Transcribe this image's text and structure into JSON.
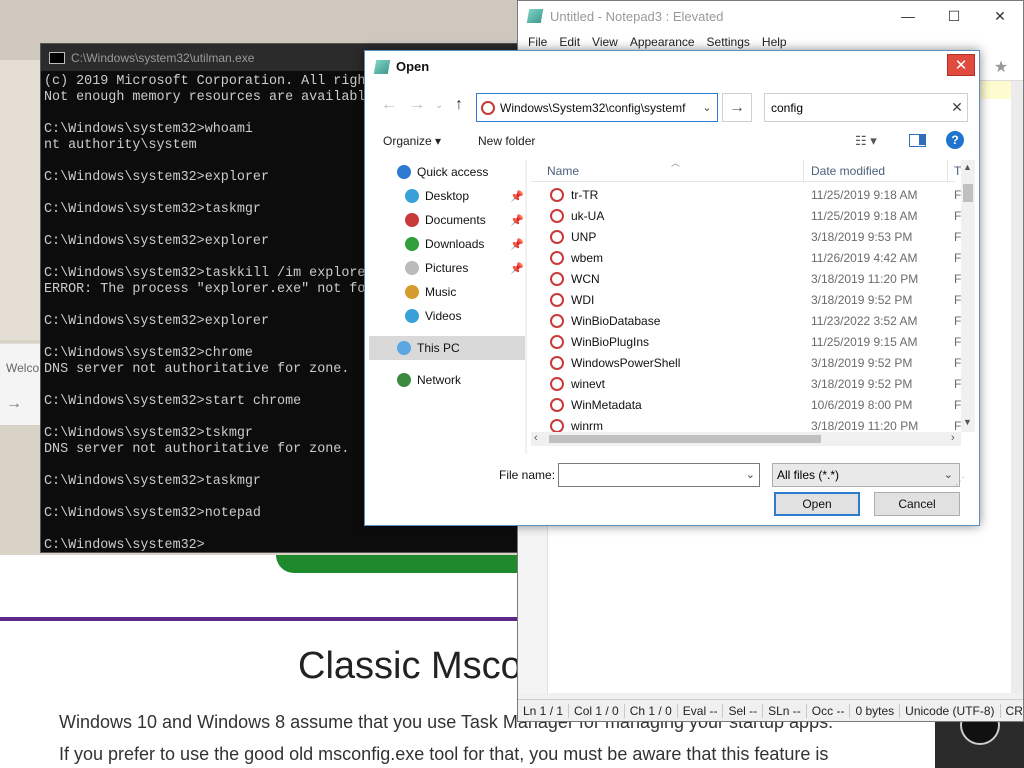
{
  "cmd": {
    "title": "C:\\Windows\\system32\\utilman.exe",
    "lines": [
      "(c) 2019 Microsoft Corporation. All righ",
      "Not enough memory resources are availabl",
      "",
      "C:\\Windows\\system32>whoami",
      "nt authority\\system",
      "",
      "C:\\Windows\\system32>explorer",
      "",
      "C:\\Windows\\system32>taskmgr",
      "",
      "C:\\Windows\\system32>explorer",
      "",
      "C:\\Windows\\system32>taskkill /im explore",
      "ERROR: The process \"explorer.exe\" not fo",
      "",
      "C:\\Windows\\system32>explorer",
      "",
      "C:\\Windows\\system32>chrome",
      "DNS server not authoritative for zone.",
      "",
      "C:\\Windows\\system32>start chrome",
      "",
      "C:\\Windows\\system32>tskmgr",
      "DNS server not authoritative for zone.",
      "",
      "C:\\Windows\\system32>taskmgr",
      "",
      "C:\\Windows\\system32>notepad",
      "",
      "C:\\Windows\\system32>"
    ]
  },
  "notepad": {
    "title": "Untitled - Notepad3 : Elevated",
    "menu": [
      "File",
      "Edit",
      "View",
      "Appearance",
      "Settings",
      "Help"
    ],
    "status": [
      "Ln  1 / 1",
      "Col  1 / 0",
      "Ch  1 / 0",
      "Eval  --",
      "Sel  --",
      "SLn  --",
      "Occ  --",
      "0 bytes",
      "Unicode (UTF-8)",
      "CR+"
    ]
  },
  "browser": {
    "welcome": "Welco",
    "heading": "Classic Msco",
    "para1": "Windows 10 and Windows 8 assume that you use Task Manager for managing your startup apps.",
    "para2": "If you prefer to use the good old msconfig.exe tool for that, you must be aware that this feature is"
  },
  "dialog": {
    "title": "Open",
    "address": "Windows\\System32\\config\\systemf",
    "search_value": "config",
    "organize": "Organize",
    "new_folder": "New folder",
    "nav": [
      {
        "label": "Quick access",
        "icon": "star-icon",
        "color": "#2e7bd1",
        "pinned": false,
        "selected": false
      },
      {
        "label": "Desktop",
        "icon": "desktop-icon",
        "color": "#3aa0d8",
        "pinned": true,
        "selected": false
      },
      {
        "label": "Documents",
        "icon": "documents-icon",
        "color": "#c93a3a",
        "pinned": true,
        "selected": false
      },
      {
        "label": "Downloads",
        "icon": "downloads-icon",
        "color": "#2e9f3a",
        "pinned": true,
        "selected": false
      },
      {
        "label": "Pictures",
        "icon": "pictures-icon",
        "color": "#bbbbbb",
        "pinned": true,
        "selected": false
      },
      {
        "label": "Music",
        "icon": "music-icon",
        "color": "#d69a2e",
        "pinned": false,
        "selected": false
      },
      {
        "label": "Videos",
        "icon": "videos-icon",
        "color": "#3aa0d8",
        "pinned": false,
        "selected": false
      },
      {
        "label": "This PC",
        "icon": "this-pc-icon",
        "color": "#5aa6e0",
        "pinned": false,
        "selected": true
      },
      {
        "label": "Network",
        "icon": "network-icon",
        "color": "#3c8b3c",
        "pinned": false,
        "selected": false
      }
    ],
    "columns": {
      "name": "Name",
      "date": "Date modified",
      "type": "Ty"
    },
    "files": [
      {
        "name": "tr-TR",
        "date": "11/25/2019 9:18 AM",
        "type": "Fi"
      },
      {
        "name": "uk-UA",
        "date": "11/25/2019 9:18 AM",
        "type": "Fi"
      },
      {
        "name": "UNP",
        "date": "3/18/2019 9:53 PM",
        "type": "Fi"
      },
      {
        "name": "wbem",
        "date": "11/26/2019 4:42 AM",
        "type": "Fi"
      },
      {
        "name": "WCN",
        "date": "3/18/2019 11:20 PM",
        "type": "Fi"
      },
      {
        "name": "WDI",
        "date": "3/18/2019 9:52 PM",
        "type": "Fi"
      },
      {
        "name": "WinBioDatabase",
        "date": "11/23/2022 3:52 AM",
        "type": "Fi"
      },
      {
        "name": "WinBioPlugIns",
        "date": "11/25/2019 9:15 AM",
        "type": "Fi"
      },
      {
        "name": "WindowsPowerShell",
        "date": "3/18/2019 9:52 PM",
        "type": "Fi"
      },
      {
        "name": "winevt",
        "date": "3/18/2019 9:52 PM",
        "type": "Fi"
      },
      {
        "name": "WinMetadata",
        "date": "10/6/2019 8:00 PM",
        "type": "Fi"
      },
      {
        "name": "winrm",
        "date": "3/18/2019 11:20 PM",
        "type": "Fi"
      }
    ],
    "file_name_label": "File name:",
    "file_name_value": "",
    "file_type": "All files (*.*)",
    "open_label": "Open",
    "cancel_label": "Cancel"
  }
}
